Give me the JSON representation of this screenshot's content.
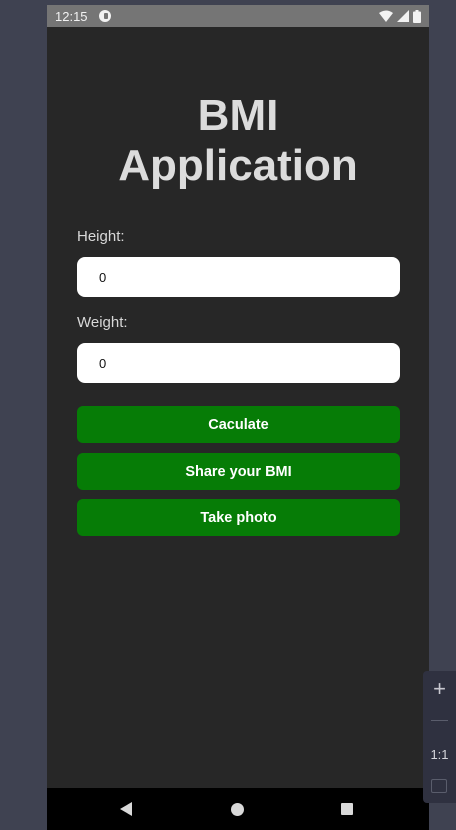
{
  "status_bar": {
    "time": "12:15",
    "app_icon": "notification-app-icon",
    "icons": [
      "wifi-icon",
      "signal-icon",
      "battery-icon"
    ]
  },
  "app": {
    "title_line1": "BMI",
    "title_line2": "Application"
  },
  "form": {
    "height_label": "Height:",
    "height_value": "0",
    "weight_label": "Weight:",
    "weight_value": "0"
  },
  "buttons": {
    "calculate": "Caculate",
    "share": "Share your BMI",
    "photo": "Take photo"
  },
  "nav": {
    "icons": [
      "back-icon",
      "home-icon",
      "recents-icon"
    ]
  },
  "zoom_panel": {
    "plus": "+",
    "ratio": "1:1"
  },
  "colors": {
    "button_green": "#067c06",
    "background_dark": "#272727",
    "input_bg": "#ffffff"
  }
}
